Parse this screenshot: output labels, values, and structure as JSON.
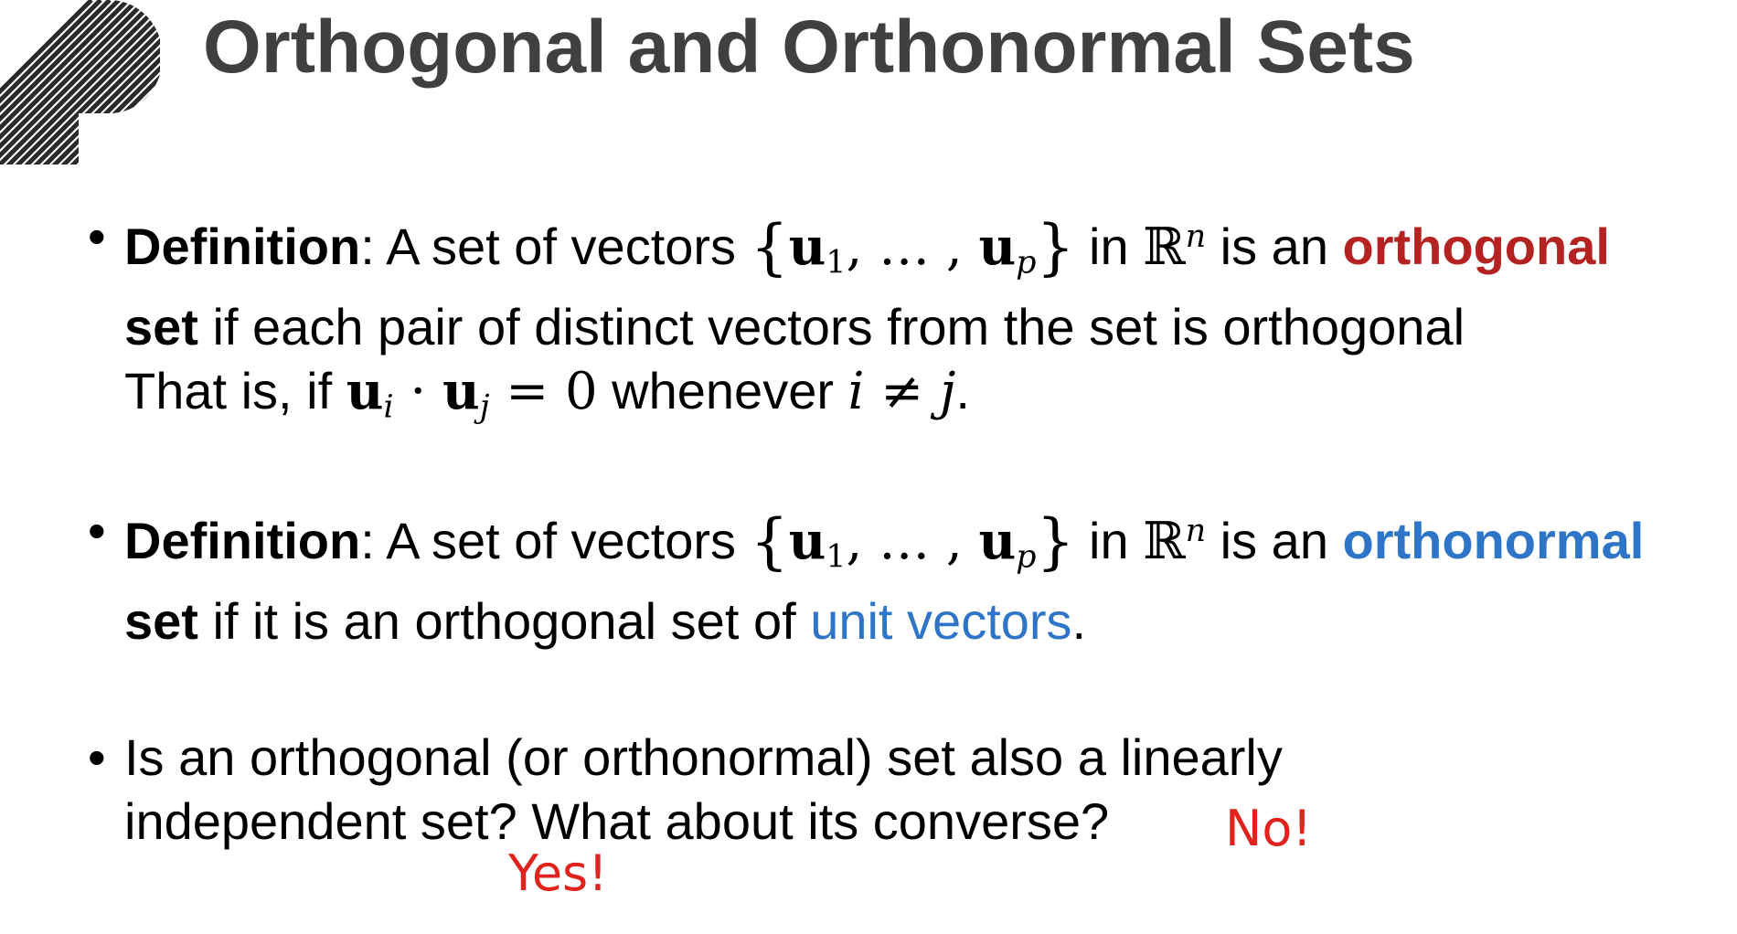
{
  "slide": {
    "title": "Orthogonal and Orthonormal Sets",
    "bullet1": {
      "line1_label": "Definition",
      "line1_a": ": A set of vectors ",
      "line1_b": " in ",
      "line1_c": " is an ",
      "keyword": "orthogonal",
      "line2_bold": "set",
      "line2_rest": " if each pair of distinct vectors from the set is orthogonal",
      "line3_a": "That is, if ",
      "line3_b": " whenever ",
      "line3_c": "."
    },
    "bullet2": {
      "line1_label": "Definition",
      "line1_a": ": A set of vectors ",
      "line1_b": " in ",
      "line1_c": " is an ",
      "keyword": "orthonormal",
      "line2_bold": "set",
      "line2_a": " if it is an orthogonal set of ",
      "line2_link": "unit vectors",
      "line2_end": "."
    },
    "bullet3": {
      "line1": "Is an orthogonal (or orthonormal) set also a linearly",
      "line2": "independent set? What about its converse?"
    },
    "answers": {
      "no": "No!",
      "yes": "Yes!"
    },
    "math": {
      "vec": "u",
      "sub1": "1",
      "ellipsis": ", … , ",
      "subp": "p",
      "reals": "ℝ",
      "supn": "n",
      "subi": "i",
      "subj": "j",
      "dot_op": " · ",
      "eq": " = 0",
      "i": "i",
      "neq": " ≠ ",
      "j": "j",
      "brace_open": "{",
      "brace_close": "}",
      "comma": ", … , "
    },
    "colors": {
      "title": "#404040",
      "orthogonal": "#b52222",
      "orthonormal": "#2e75c7",
      "answers": "#e0231d"
    },
    "icons": {
      "decoration": "striped-circle-decoration-icon",
      "bullet": "bullet-dot-icon"
    }
  }
}
